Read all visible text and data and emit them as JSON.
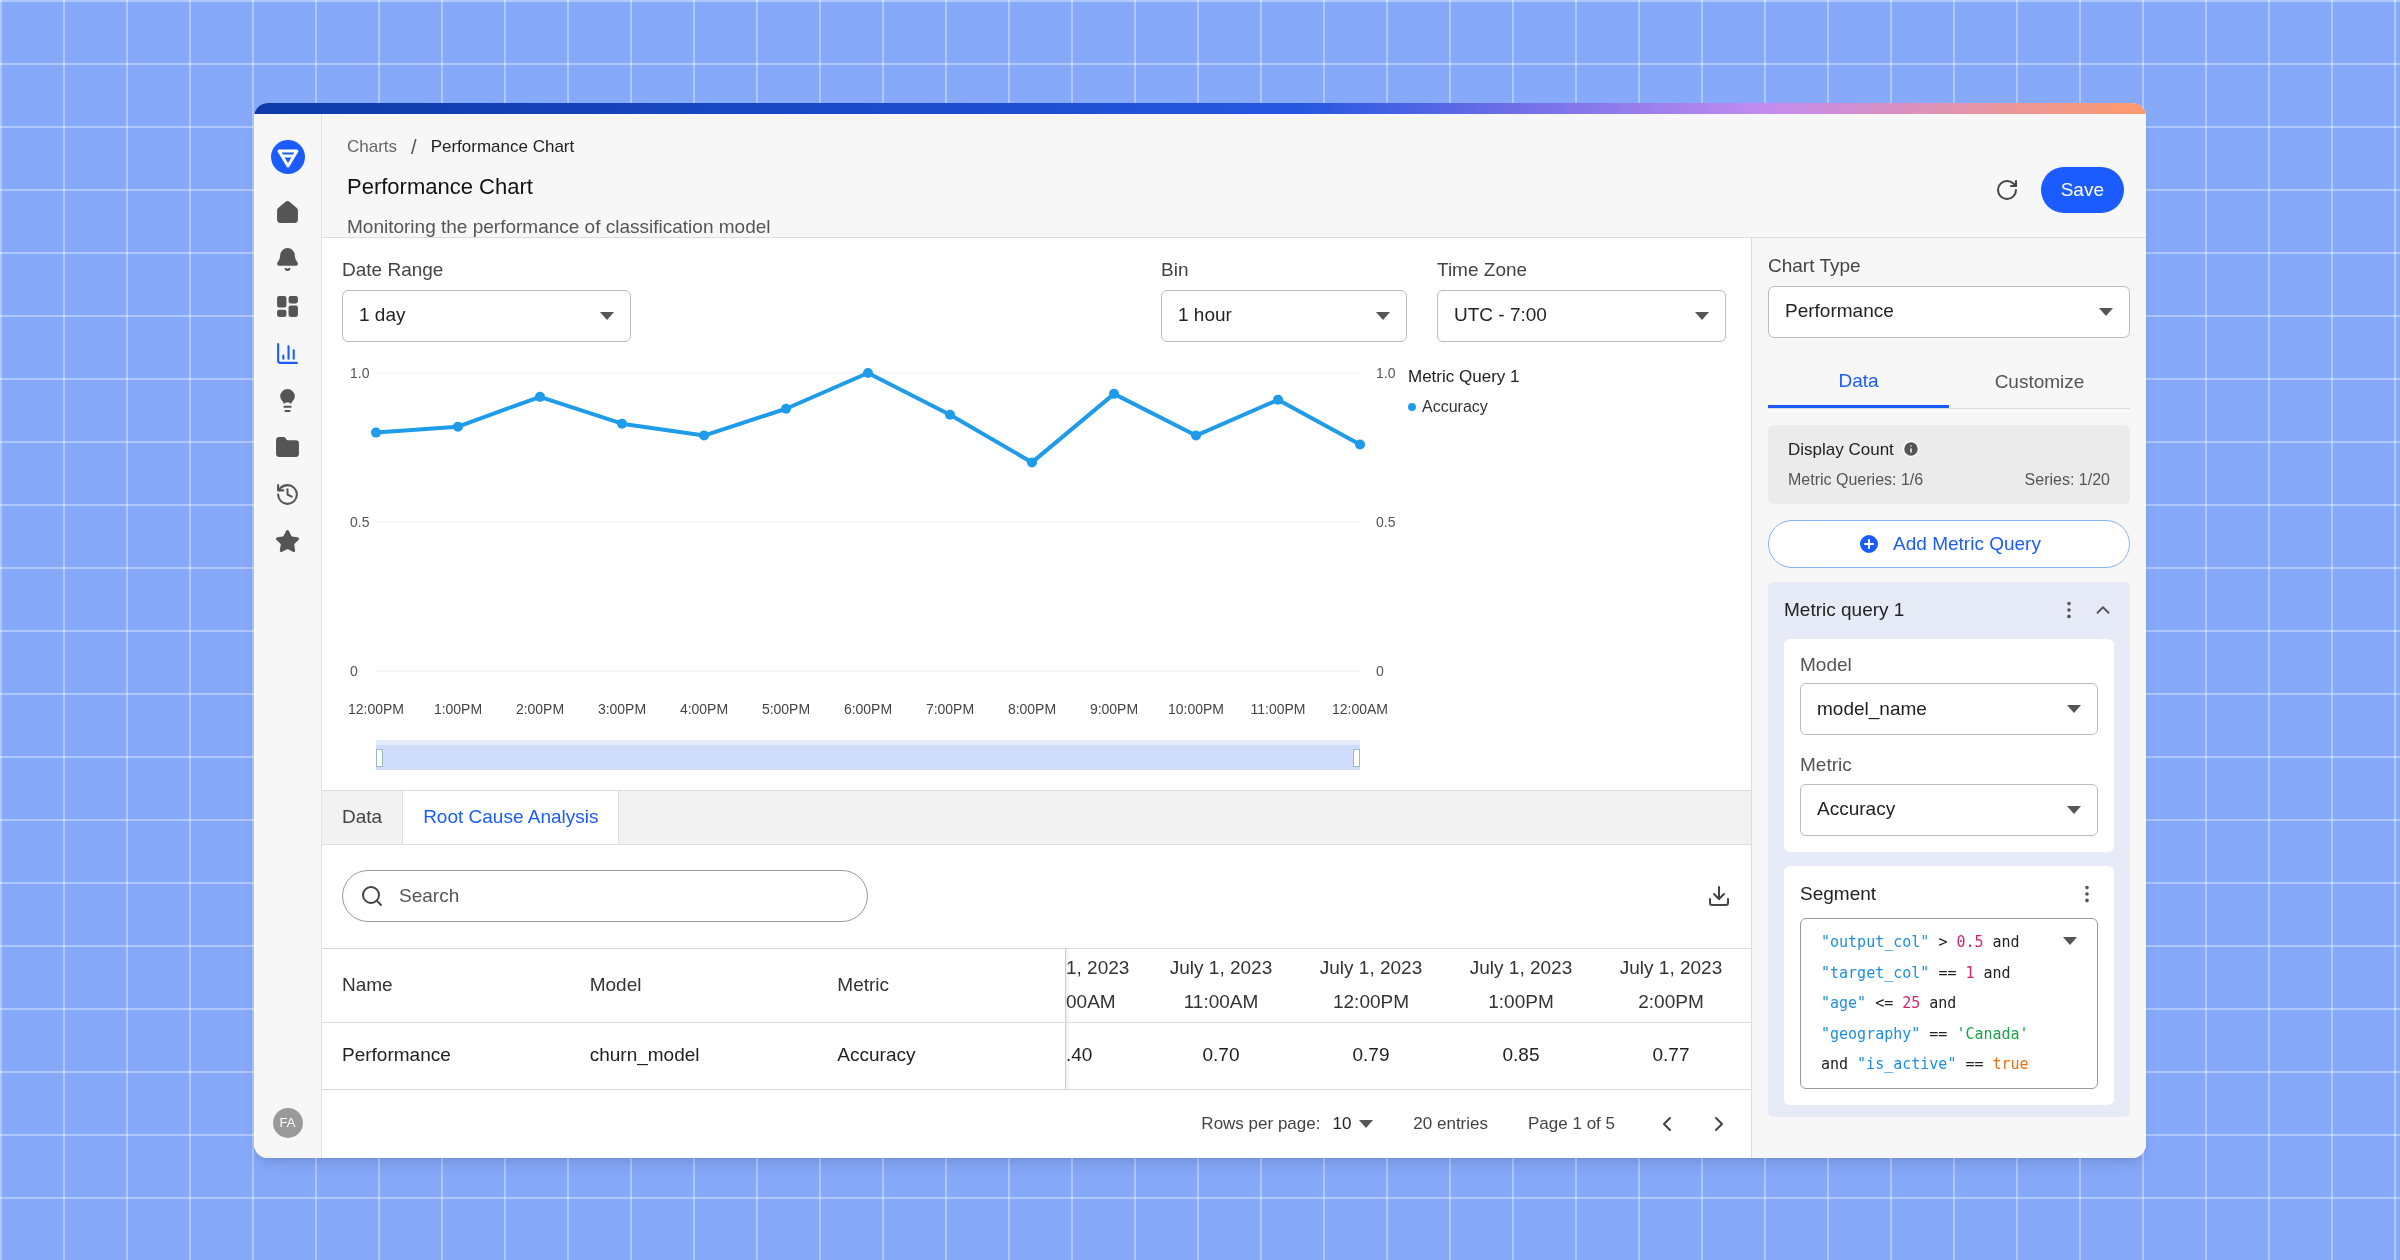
{
  "sidebar": {
    "items": [
      {
        "kind": "home",
        "selected": false
      },
      {
        "kind": "bell",
        "selected": false
      },
      {
        "kind": "dashboard",
        "selected": false
      },
      {
        "kind": "chart",
        "selected": true
      },
      {
        "kind": "bulb",
        "selected": false
      },
      {
        "kind": "folder",
        "selected": false
      },
      {
        "kind": "history",
        "selected": false
      },
      {
        "kind": "star",
        "selected": false
      }
    ],
    "avatar": "FA"
  },
  "breadcrumb": [
    "Charts",
    "/",
    "Performance Chart"
  ],
  "title": "Performance Chart",
  "subtitle": "Monitoring the performance of classification model",
  "save_button": "Save",
  "filters": [
    {
      "label": "Date Range",
      "value": "1 day"
    },
    {
      "label": "Bin",
      "value": "1 hour"
    },
    {
      "label": "Time Zone",
      "value": "UTC - 7:00"
    }
  ],
  "chart": {
    "legend_title": "Metric Query 1",
    "right_axis_labels": [
      "1.0",
      "0.5",
      "0"
    ],
    "range_slider": {
      "level": 1
    },
    "chart_data": {
      "type": "line",
      "categories": [
        "12:00PM",
        "1:00PM",
        "2:00PM",
        "3:00PM",
        "4:00PM",
        "5:00PM",
        "6:00PM",
        "7:00PM",
        "8:00PM",
        "9:00PM",
        "10:00PM",
        "11:00PM",
        "12:00AM"
      ],
      "series": [
        {
          "name": "Accuracy",
          "color": "#1e9be9",
          "marker": true,
          "values": [
            0.8,
            0.82,
            0.92,
            0.83,
            0.79,
            0.88,
            1.0,
            0.86,
            0.7,
            0.93,
            0.79,
            0.91,
            0.76
          ]
        }
      ],
      "ylim": [
        0,
        1
      ],
      "yticks": [
        0,
        0.5,
        {
          "value": 1,
          "label": "1.0"
        }
      ]
    }
  },
  "bottom_tabs": [
    {
      "label": "Data",
      "selected": false
    },
    {
      "label": "Root Cause Analysis",
      "selected": true
    }
  ],
  "search": {
    "placeholder": "Search"
  },
  "table": {
    "pinned_columns": [
      "Name",
      "Model",
      "Metric"
    ],
    "pinned_rows": [
      [
        "Performance",
        "churn_model",
        "Accuracy"
      ]
    ],
    "columns": [
      {
        "date": "1, 2023",
        "time": "00AM"
      },
      {
        "date": "July 1, 2023",
        "time": "11:00AM"
      },
      {
        "date": "July 1, 2023",
        "time": "12:00PM"
      },
      {
        "date": "July 1, 2023",
        "time": "1:00PM"
      },
      {
        "date": "July 1, 2023",
        "time": "2:00PM"
      }
    ],
    "rows": [
      [
        ".40",
        "0.70",
        "0.79",
        "0.85",
        "0.77"
      ]
    ]
  },
  "pagination": {
    "rows_per_page_label": "Rows per page:",
    "rows_per_page": "10",
    "entries": "20 entries",
    "page": "Page 1 of 5"
  },
  "right_panel": {
    "chart_type": {
      "label": "Chart Type",
      "value": "Performance"
    },
    "tabs": [
      {
        "label": "Data",
        "selected": true
      },
      {
        "label": "Customize",
        "selected": false
      }
    ],
    "display_count": {
      "title": "Display Count",
      "queries": "Metric Queries: 1/6",
      "series": "Series: 1/20"
    },
    "add_button": "Add Metric Query",
    "metric_query": {
      "title": "Metric query 1",
      "expanded": true,
      "fields": [
        {
          "label": "Model",
          "value": "model_name"
        },
        {
          "label": "Metric",
          "value": "Accuracy"
        }
      ],
      "segment": {
        "title": "Segment",
        "lines": [
          [
            {
              "kind": "field",
              "text": "\"output_col\""
            },
            {
              "kind": "op",
              "text": ">"
            },
            {
              "kind": "number",
              "text": "0.5"
            },
            {
              "kind": "op",
              "text": "and"
            }
          ],
          [
            {
              "kind": "field",
              "text": "\"target_col\""
            },
            {
              "kind": "op",
              "text": "=="
            },
            {
              "kind": "number",
              "text": "1"
            },
            {
              "kind": "op",
              "text": "and"
            }
          ],
          [
            {
              "kind": "field",
              "text": "\"age\""
            },
            {
              "kind": "op",
              "text": "<="
            },
            {
              "kind": "number",
              "text": "25"
            },
            {
              "kind": "op",
              "text": "and"
            }
          ],
          [
            {
              "kind": "field",
              "text": "\"geography\""
            },
            {
              "kind": "op",
              "text": "=="
            },
            {
              "kind": "string",
              "text": "'Canada'"
            }
          ],
          [
            {
              "kind": "op",
              "text": "and"
            },
            {
              "kind": "field",
              "text": "\"is_active\""
            },
            {
              "kind": "op",
              "text": "=="
            },
            {
              "kind": "bool",
              "text": "true"
            }
          ]
        ]
      }
    }
  }
}
